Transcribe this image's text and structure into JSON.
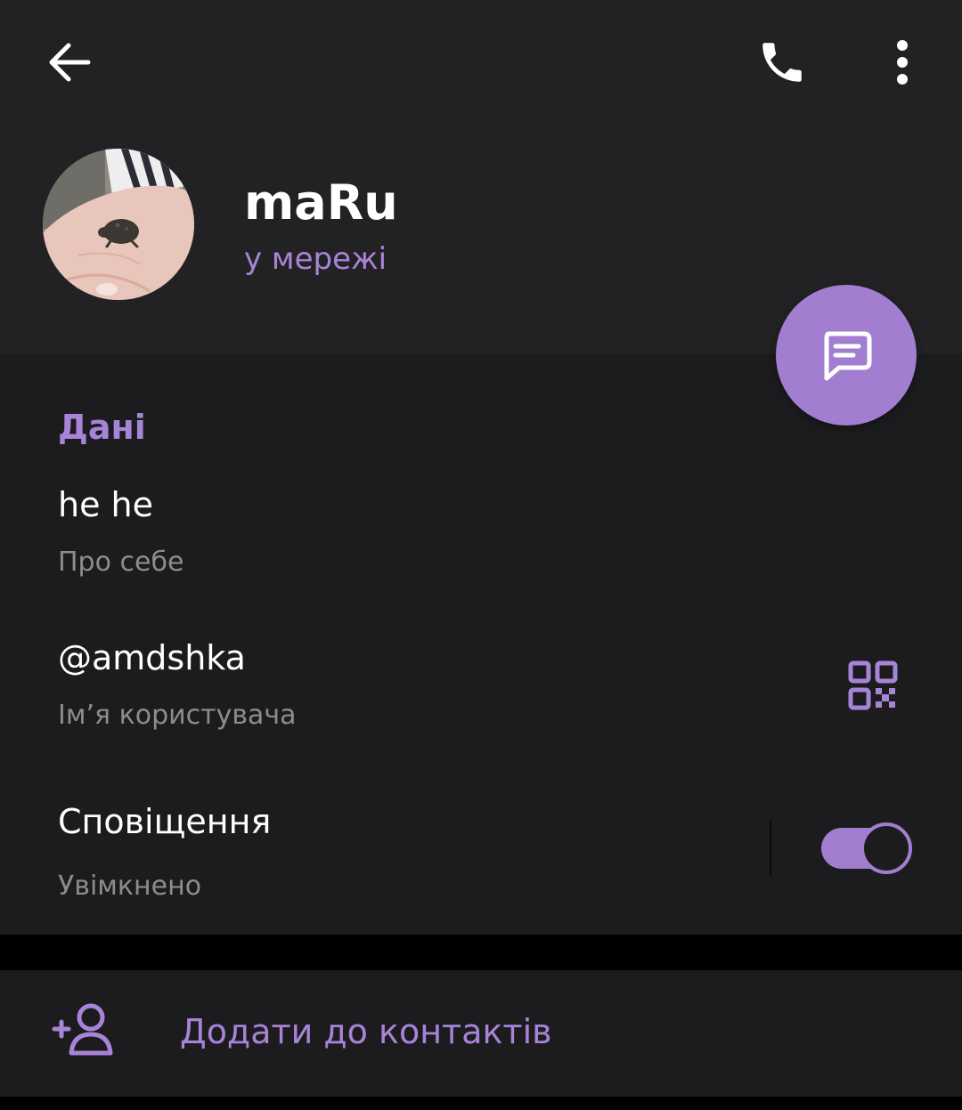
{
  "toolbar": {
    "back_icon": "arrow-left-icon",
    "call_icon": "phone-icon",
    "more_icon": "more-vertical-icon"
  },
  "profile": {
    "name": "maRu",
    "status": "у мережі",
    "avatar": "frog-on-hand-photo"
  },
  "fab": {
    "icon": "message-icon"
  },
  "info": {
    "section_title": "Дані",
    "bio": {
      "value": "he he",
      "label": "Про себе"
    },
    "username": {
      "value": "@amdshka",
      "label": "Ім’я користувача",
      "action_icon": "qr-code-icon"
    },
    "notifications": {
      "value": "Сповіщення",
      "label": "Увімкнено",
      "enabled": true
    }
  },
  "add_contact": {
    "label": "Додати до контактів",
    "icon": "add-user-icon"
  },
  "colors": {
    "accent": "#a27ed0",
    "accent_text": "#a884d8",
    "header_bg": "#222224",
    "section_bg": "#1c1c1e",
    "text_primary": "#ffffff",
    "text_secondary": "#8d8d90"
  }
}
